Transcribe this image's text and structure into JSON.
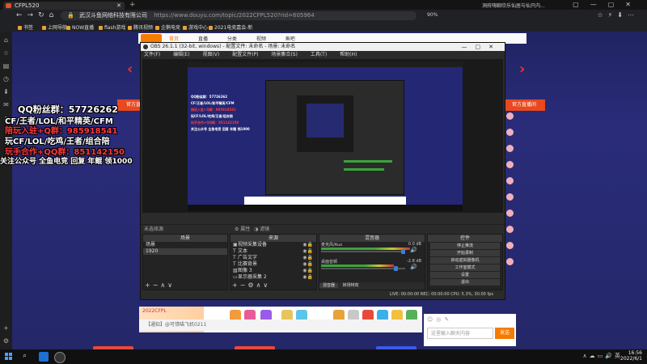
{
  "browser": {
    "tab_title": "CFPL520",
    "url_secure": "武汉斗鱼网络科技有限公司",
    "url": "https://www.douyu.com/topic/2022CFPL520?rid=605964",
    "zoom": "90%",
    "tab_search_hint": "洞府嗨聊欣乐仙居与仙只内...",
    "bookmarks": [
      "书签",
      "上网导航",
      "NOW直播",
      "flash游戏",
      "腾讯视频",
      "企鹅电竞",
      "游戏中心",
      "2021电竞嘉会-新"
    ]
  },
  "page": {
    "promo_left": "官方直播间",
    "promo_right": "官方直播间",
    "nav_links": [
      "首页",
      "直播",
      "分类",
      "视频",
      "鱼吧"
    ],
    "overlay_lines": [
      {
        "text": "QQ粉丝群：57726262",
        "color": "#ffffff"
      },
      {
        "text": "CF/王者/LOL/和平精英/CFM",
        "color": "#ffffff"
      },
      {
        "text": "陪玩入驻+Q群：985918541",
        "color": "#ff3333"
      },
      {
        "text": "玩CF/LOL/吃鸡/王者/组合陪",
        "color": "#ffffff"
      },
      {
        "text": "玩手合作+QQ群：851142150",
        "color": "#ff3333"
      },
      {
        "text": "关注公众号 全鱼电竞 回复 年鲲 领1000",
        "color": "#ffffff"
      }
    ],
    "chat_placeholder": "这里输入聊天内容",
    "chat_send": "发送",
    "gift_footer": "【通知】@可惜喵飞机0211",
    "gift_ad": "2022CFPL"
  },
  "obs": {
    "title": "OBS 26.1.1 (32-bit, windows) - 配置文件: 未命名 - 场景: 未命名",
    "menu": [
      "文件(F)",
      "编辑(E)",
      "视图(V)",
      "配置文件(P)",
      "场景集合(S)",
      "工具(T)",
      "帮助(H)"
    ],
    "no_source": "未选择源",
    "prop_btn": "属性",
    "filter_btn": "滤镜",
    "panels": {
      "scenes": "场景",
      "sources": "来源",
      "mixer": "混音器",
      "controls": "控件"
    },
    "scenes": [
      "场景",
      "1920"
    ],
    "sources": [
      "视频采集设备",
      "文本",
      "广告文字",
      "比赛背景",
      "图像 3",
      "显示器采集 2"
    ],
    "mixer": [
      {
        "name": "麦克风/Aux",
        "value": "0.0 dB"
      },
      {
        "name": "桌面音频",
        "value": "-2.8 dB"
      }
    ],
    "mixer_tabs": [
      "混音器",
      "转场特效"
    ],
    "controls": [
      "停止推流",
      "开始录制",
      "启动虚拟摄像机",
      "工作室模式",
      "设置",
      "退出"
    ],
    "status": "LIVE: 00:00:00   REC: 00:00:00   CPU: 5.3%, 30.00 fps"
  },
  "taskbar": {
    "time": "16:56",
    "date": "2022/6/1",
    "lang": "英"
  }
}
